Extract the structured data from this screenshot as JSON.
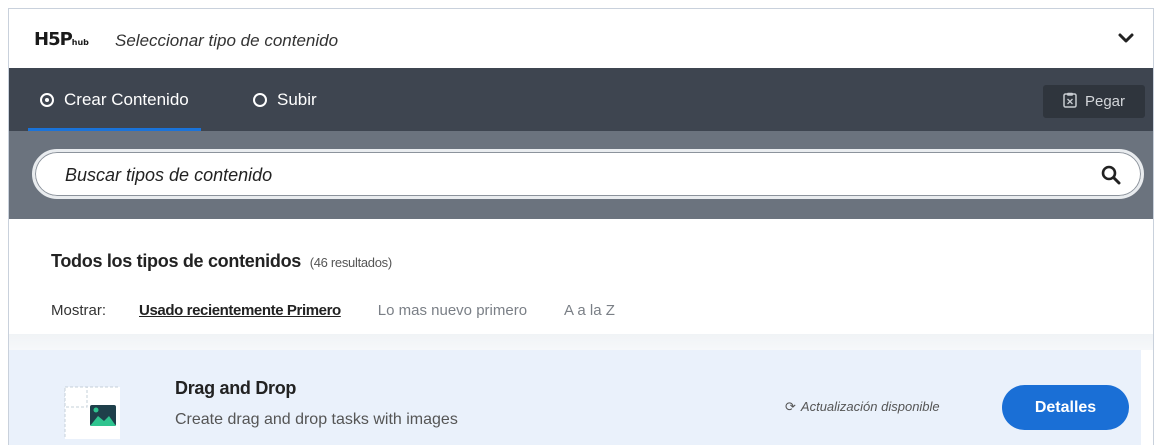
{
  "header": {
    "logo_main": "H5P",
    "logo_sub": "hub",
    "title": "Seleccionar tipo de contenido"
  },
  "tabs": {
    "create_label": "Crear Contenido",
    "upload_label": "Subir",
    "active": "create"
  },
  "toolbar": {
    "paste_label": "Pegar"
  },
  "search": {
    "placeholder": "Buscar tipos de contenido"
  },
  "results": {
    "title": "Todos los tipos de contenidos",
    "count": "(46 resultados)",
    "sort_label": "Mostrar:",
    "sort_options": [
      "Usado recientemente Primero",
      "Lo mas nuevo primero",
      "A a la Z"
    ],
    "sort_active": "Usado recientemente Primero"
  },
  "items": [
    {
      "title": "Drag and Drop",
      "description": "Create drag and drop tasks with images",
      "status": "Actualización disponible",
      "button": "Detalles"
    }
  ],
  "colors": {
    "tabbar_bg": "#3e4550",
    "search_bg": "#6b737e",
    "accent": "#1a6fd6",
    "item_bg": "#eaf1fb"
  },
  "icons": [
    "chevron-down-icon",
    "radio-checked-icon",
    "radio-unchecked-icon",
    "clipboard-icon",
    "search-icon",
    "refresh-icon",
    "drag-and-drop-icon"
  ]
}
